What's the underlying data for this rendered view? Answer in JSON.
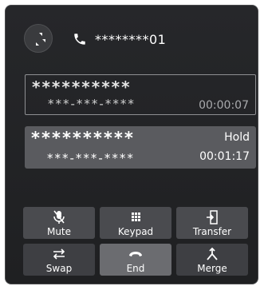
{
  "header": {
    "number": "********01",
    "minimize_icon": "minimize-arrows-icon",
    "phone_icon": "phone-icon"
  },
  "calls": [
    {
      "name": "**********",
      "number": "***-***-****",
      "duration": "00:00:07",
      "status": ""
    },
    {
      "name": "**********",
      "number": "***-***-****",
      "duration": "00:01:17",
      "status": "Hold"
    }
  ],
  "controls": {
    "mute": "Mute",
    "keypad": "Keypad",
    "transfer": "Transfer",
    "swap": "Swap",
    "end": "End",
    "merge": "Merge"
  },
  "colors": {
    "panel": "#222325",
    "hold_card": "#5a5b5f",
    "button": "#4a4b4f"
  }
}
